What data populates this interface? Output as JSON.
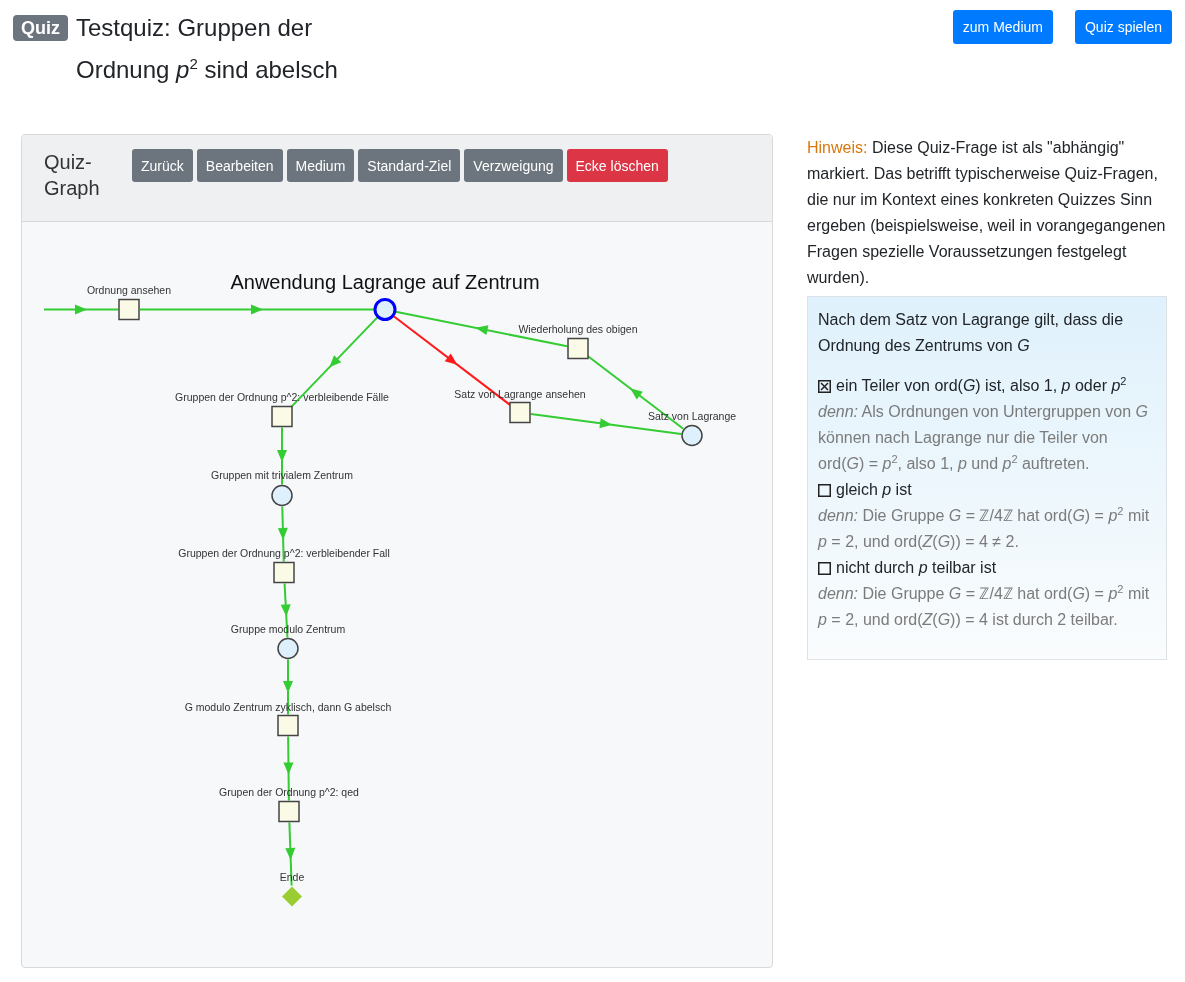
{
  "header": {
    "badge": "Quiz",
    "title": "Testquiz: Gruppen der Ordnung *p*$^{2}$ sind abelsch",
    "buttons": [
      "zum Medium",
      "Quiz spielen"
    ]
  },
  "graph_panel": {
    "title": "Quiz-Graph",
    "buttons": [
      {
        "label": "Zurück",
        "kind": "secondary"
      },
      {
        "label": "Bearbeiten",
        "kind": "secondary"
      },
      {
        "label": "Medium",
        "kind": "secondary"
      },
      {
        "label": "Standard-Ziel",
        "kind": "secondary"
      },
      {
        "label": "Verzweigung",
        "kind": "secondary"
      },
      {
        "label": "Ecke löschen",
        "kind": "danger"
      }
    ],
    "nodes": [
      {
        "label": "Ordnung ansehen",
        "kind": "step",
        "selected": false
      },
      {
        "label": "Anwendung Lagrange auf Zentrum",
        "kind": "topic",
        "selected": true
      },
      {
        "label": "Wiederholung des obigen",
        "kind": "step",
        "selected": false
      },
      {
        "label": "Gruppen der Ordnung p^2: verbleibende Fälle",
        "kind": "step",
        "selected": false
      },
      {
        "label": "Satz von Lagrange ansehen",
        "kind": "step",
        "selected": false
      },
      {
        "label": "Satz von Lagrange",
        "kind": "topic",
        "selected": false
      },
      {
        "label": "Gruppen mit trivialem Zentrum",
        "kind": "topic",
        "selected": false
      },
      {
        "label": "Gruppen der Ordnung p^2: verbleibender Fall",
        "kind": "step",
        "selected": false
      },
      {
        "label": "Gruppe modulo Zentrum",
        "kind": "topic",
        "selected": false
      },
      {
        "label": "G modulo Zentrum zyklisch, dann G abelsch",
        "kind": "step",
        "selected": false
      },
      {
        "label": "Grupen der Ordnung p^2: qed",
        "kind": "step",
        "selected": false
      },
      {
        "label": "Ende",
        "kind": "end",
        "selected": false
      }
    ],
    "edges": [
      {
        "color": "#33cc33"
      },
      {
        "color": "#33cc33"
      },
      {
        "color": "#33cc33"
      },
      {
        "color": "#ff1a1a"
      },
      {
        "color": "#33cc33"
      },
      {
        "color": "#33cc33"
      },
      {
        "color": "#33cc33"
      },
      {
        "color": "#33cc33"
      },
      {
        "color": "#33cc33"
      },
      {
        "color": "#33cc33"
      },
      {
        "color": "#33cc33"
      },
      {
        "color": "#33cc33"
      },
      {
        "color": "#33cc33"
      }
    ]
  },
  "hint": {
    "label": "Hinweis:",
    "text": "Diese Quiz-Frage ist als \"abhängig\" markiert. Das betrifft typischerweise Quiz-Fragen, die nur im Kontext eines konkreten Quizzes Sinn ergeben (beispielsweise, weil in vorangegangenen Fragen spezielle Voraussetzungen festgelegt wurden)."
  },
  "question": {
    "text": "Nach dem Satz von Lagrange gilt, dass die Ordnung des Zentrums von *G*",
    "answers": [
      {
        "text": "ein Teiler von ord(*G*) ist, also 1, *p* oder *p*$^{2}$",
        "checked": true,
        "explanation": "*denn:* Als Ordnungen von Untergruppen von *G* können nach Lagrange nur die Teiler von ord(*G*) = *p*$^{2}$, also 1, *p* und *p*$^{2}$ auftreten."
      },
      {
        "text": "gleich *p* ist",
        "checked": false,
        "explanation": "*denn:* Die Gruppe *G* = ℤ/4ℤ hat ord(*G*) = *p*$^{2}$ mit *p* = 2, und ord(*Z*(*G*)) = 4 ≠ 2."
      },
      {
        "text": "nicht durch *p* teilbar ist",
        "checked": false,
        "explanation": "*denn:* Die Gruppe *G* = ℤ/4ℤ hat ord(*G*) = *p*$^{2}$ mit *p* = 2, und ord(*Z*(*G*)) = 4 ist durch 2 teilbar."
      }
    ]
  }
}
